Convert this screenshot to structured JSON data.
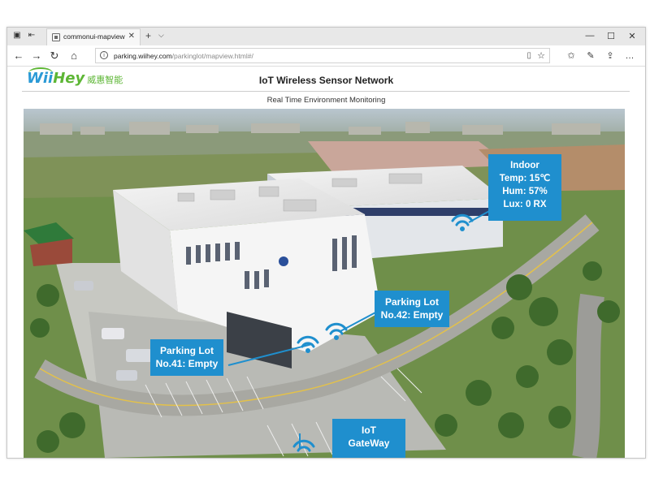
{
  "browser": {
    "tab_title": "commonui-mapview",
    "url_host": "parking.wiihey.com",
    "url_path": "/parkinglot/mapview.html#/"
  },
  "page": {
    "logo_text_1": "Wii",
    "logo_text_2": "Hey",
    "logo_cn": "威惠智能",
    "title": "IoT Wireless Sensor Network",
    "subtitle": "Real Time Environment Monitoring"
  },
  "sensors": {
    "indoor": {
      "name": "Indoor",
      "temp": "Temp: 15℃",
      "hum": "Hum: 57%",
      "lux": "Lux: 0 RX"
    },
    "lot42": {
      "line1": "Parking Lot",
      "line2": "No.42: Empty"
    },
    "lot41": {
      "line1": "Parking Lot",
      "line2": "No.41: Empty"
    },
    "gateway": {
      "line1": "IoT",
      "line2": "GateWay"
    }
  },
  "colors": {
    "info_box": "#1f8fce",
    "signal": "#1f8fce",
    "grass": "#6a9a3a",
    "building": "#f2f2f2"
  }
}
